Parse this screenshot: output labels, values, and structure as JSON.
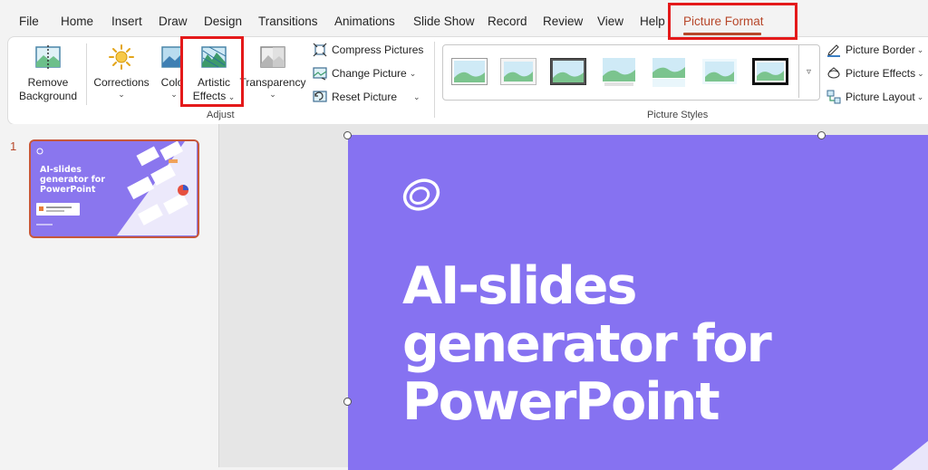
{
  "tabs": [
    {
      "label": "File"
    },
    {
      "label": "Home"
    },
    {
      "label": "Insert"
    },
    {
      "label": "Draw"
    },
    {
      "label": "Design"
    },
    {
      "label": "Transitions"
    },
    {
      "label": "Animations"
    },
    {
      "label": "Slide Show"
    },
    {
      "label": "Record"
    },
    {
      "label": "Review"
    },
    {
      "label": "View"
    },
    {
      "label": "Help"
    },
    {
      "label": "Picture Format"
    }
  ],
  "active_tab": "Picture Format",
  "ribbon": {
    "adjust": {
      "remove_background": {
        "line1": "Remove",
        "line2": "Background"
      },
      "corrections": "Corrections",
      "color": "Color",
      "artistic_effects": {
        "line1": "Artistic",
        "line2": "Effects"
      },
      "transparency": "Transparency",
      "compress_pictures": "Compress Pictures",
      "change_picture": "Change Picture",
      "reset_picture": "Reset Picture",
      "group_label": "Adjust"
    },
    "picture_styles": {
      "group_label": "Picture Styles",
      "picture_border": "Picture Border",
      "picture_effects": "Picture Effects",
      "picture_layout": "Picture Layout"
    }
  },
  "thumbnail": {
    "number": "1",
    "title_line1": "AI-slides",
    "title_line2": "generator for",
    "title_line3": "PowerPoint"
  },
  "slide": {
    "title_line1": "AI-slides",
    "title_line2": "generator for",
    "title_line3": "PowerPoint"
  },
  "colors": {
    "accent": "#b7472a",
    "slide_bg": "#8672f1",
    "highlight": "#e4191a"
  }
}
